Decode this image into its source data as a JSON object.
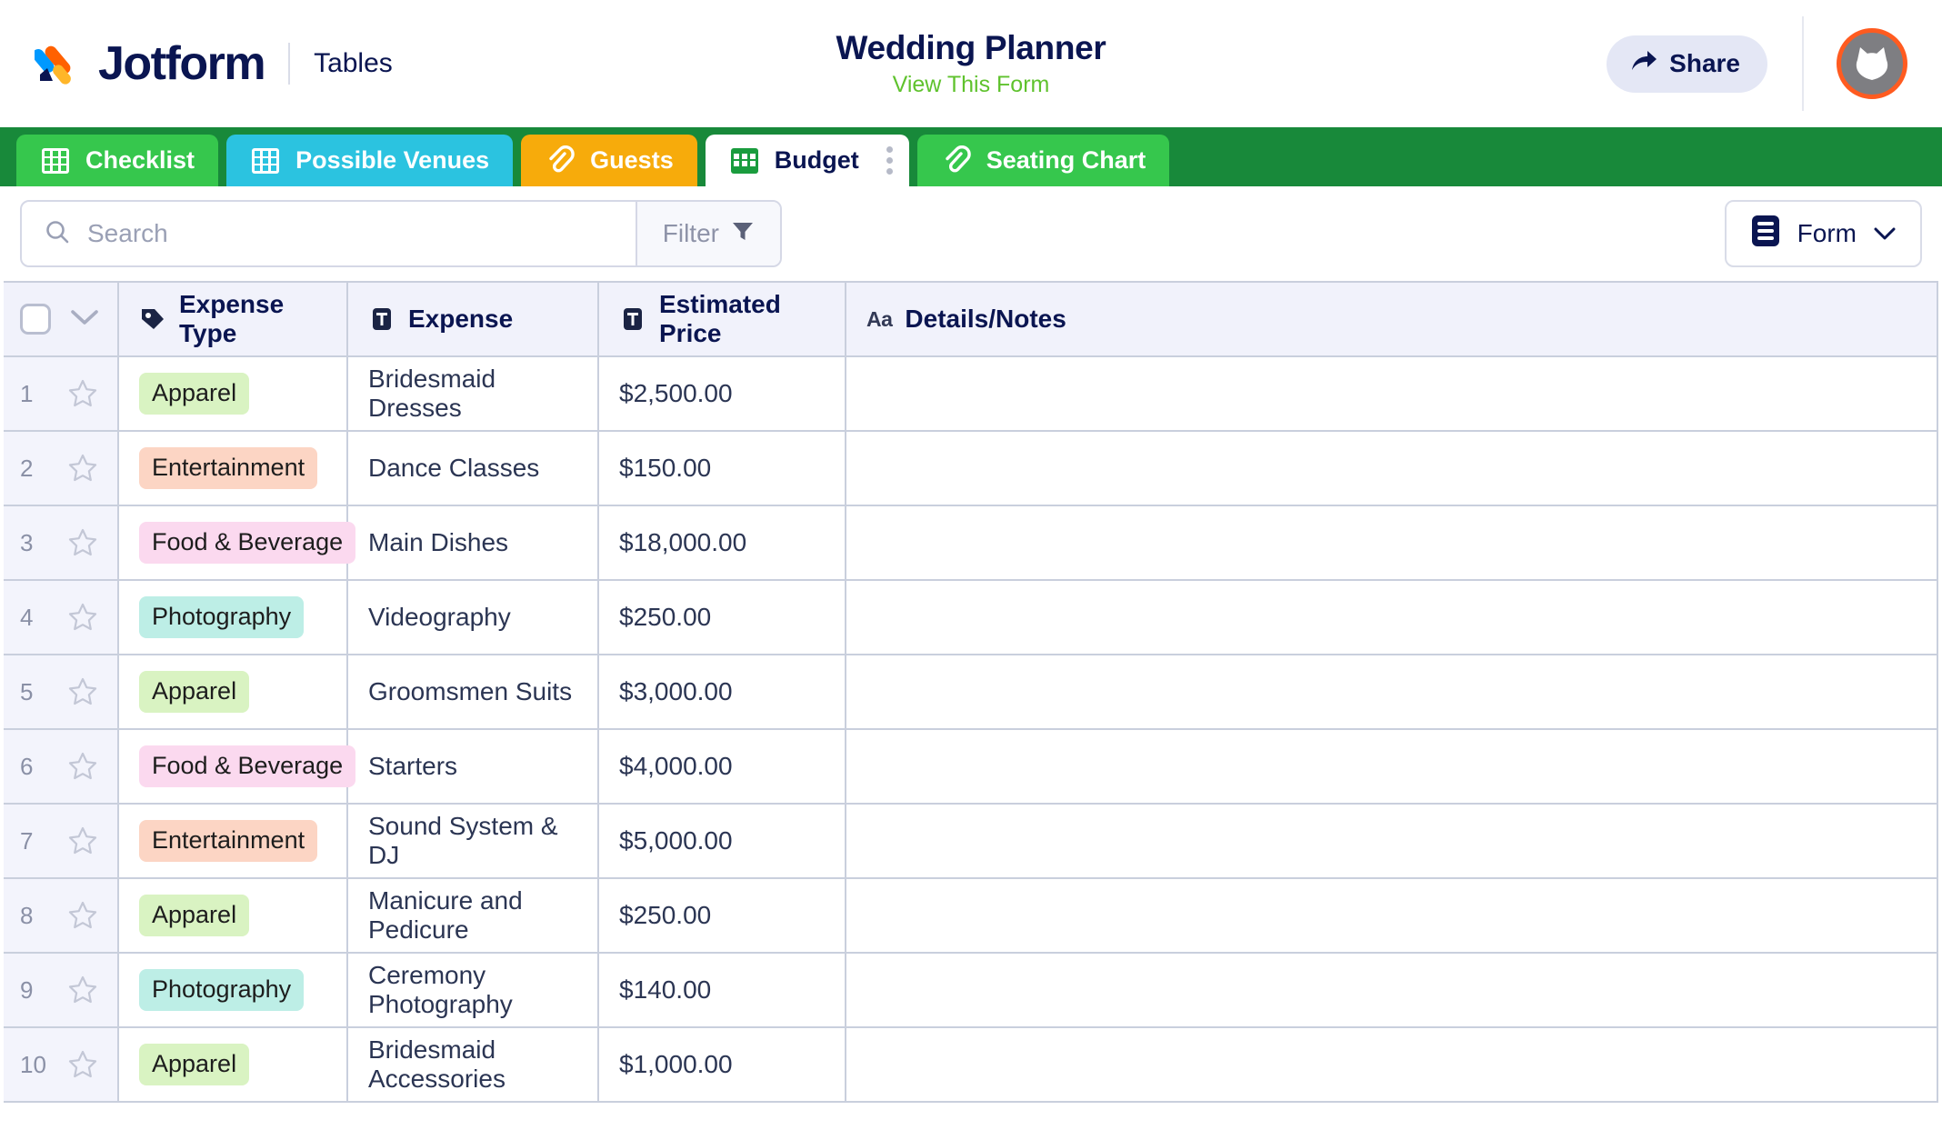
{
  "header": {
    "brand_name": "Jotform",
    "product": "Tables",
    "form_title": "Wedding Planner",
    "form_link_label": "View This Form",
    "share_label": "Share",
    "logo_icon": "jotform-logo-icon",
    "share_icon": "share-arrow-icon",
    "avatar_icon": "user-avatar-cat-icon"
  },
  "tabs": [
    {
      "label": "Checklist",
      "icon": "grid-icon",
      "color": "#36c74d",
      "active": false
    },
    {
      "label": "Possible Venues",
      "icon": "grid-icon",
      "color": "#2bc3e0",
      "active": false
    },
    {
      "label": "Guests",
      "icon": "paperclip-icon",
      "color": "#f7ab0b",
      "active": false
    },
    {
      "label": "Budget",
      "icon": "grid-icon",
      "color": "#ffffff",
      "active": true
    },
    {
      "label": "Seating Chart",
      "icon": "paperclip-icon",
      "color": "#36c74d",
      "active": false
    }
  ],
  "toolbar": {
    "search_placeholder": "Search",
    "search_value": "",
    "search_icon": "search-icon",
    "filter_label": "Filter",
    "filter_icon": "funnel-icon",
    "view_label": "Form",
    "view_icon": "form-list-icon",
    "view_chevron": "chevron-down-icon"
  },
  "table": {
    "columns": [
      {
        "label": "Expense Type",
        "icon": "tag-icon"
      },
      {
        "label": "Expense",
        "icon": "text-T-icon"
      },
      {
        "label": "Estimated Price",
        "icon": "text-T-icon"
      },
      {
        "label": "Details/Notes",
        "icon": "aa-text-icon"
      }
    ],
    "rows": [
      {
        "num": "1",
        "type": "Apparel",
        "type_color": "#d9f3c2",
        "expense": "Bridesmaid Dresses",
        "price": "$2,500.00",
        "notes": ""
      },
      {
        "num": "2",
        "type": "Entertainment",
        "type_color": "#fcd5c4",
        "expense": "Dance Classes",
        "price": "$150.00",
        "notes": ""
      },
      {
        "num": "3",
        "type": "Food & Beverage",
        "type_color": "#fbd9ef",
        "expense": "Main Dishes",
        "price": "$18,000.00",
        "notes": ""
      },
      {
        "num": "4",
        "type": "Photography",
        "type_color": "#bdeee6",
        "expense": "Videography",
        "price": "$250.00",
        "notes": ""
      },
      {
        "num": "5",
        "type": "Apparel",
        "type_color": "#d9f3c2",
        "expense": "Groomsmen Suits",
        "price": "$3,000.00",
        "notes": ""
      },
      {
        "num": "6",
        "type": "Food & Beverage",
        "type_color": "#fbd9ef",
        "expense": "Starters",
        "price": "$4,000.00",
        "notes": ""
      },
      {
        "num": "7",
        "type": "Entertainment",
        "type_color": "#fcd5c4",
        "expense": "Sound System & DJ",
        "price": "$5,000.00",
        "notes": ""
      },
      {
        "num": "8",
        "type": "Apparel",
        "type_color": "#d9f3c2",
        "expense": "Manicure and Pedicure",
        "price": "$250.00",
        "notes": ""
      },
      {
        "num": "9",
        "type": "Photography",
        "type_color": "#bdeee6",
        "expense": "Ceremony Photography",
        "price": "$140.00",
        "notes": ""
      },
      {
        "num": "10",
        "type": "Apparel",
        "type_color": "#d9f3c2",
        "expense": "Bridesmaid Accessories",
        "price": "$1,000.00",
        "notes": ""
      }
    ]
  },
  "colors": {
    "brand_navy": "#0a1551",
    "tabbar_green": "#18893a",
    "link_green": "#5fc22d",
    "avatar_ring": "#ff5b20"
  }
}
